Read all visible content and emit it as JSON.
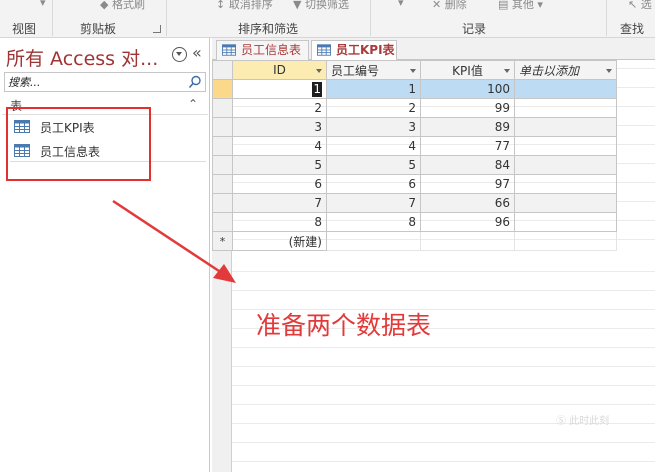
{
  "ribbon": {
    "groups": [
      {
        "label": "视图"
      },
      {
        "label": "剪贴板",
        "top": "格式刷"
      },
      {
        "label": "排序和筛选",
        "top_left": "取消排序",
        "top_right": "切换筛选"
      },
      {
        "label": "记录",
        "top_left": "删除",
        "top_right": "其他"
      },
      {
        "label": "查找",
        "top": "选"
      }
    ]
  },
  "nav": {
    "title": "所有 Access 对...",
    "search_placeholder": "搜索...",
    "group_label": "表",
    "items": [
      {
        "label": "员工KPI表"
      },
      {
        "label": "员工信息表"
      }
    ]
  },
  "tabs": [
    {
      "label": "员工信息表",
      "active": false
    },
    {
      "label": "员工KPI表",
      "active": true
    }
  ],
  "table": {
    "columns": [
      "ID",
      "员工编号",
      "KPI值",
      "单击以添加"
    ],
    "rows": [
      {
        "id": "1",
        "emp": "1",
        "kpi": "100"
      },
      {
        "id": "2",
        "emp": "2",
        "kpi": "99"
      },
      {
        "id": "3",
        "emp": "3",
        "kpi": "89"
      },
      {
        "id": "4",
        "emp": "4",
        "kpi": "77"
      },
      {
        "id": "5",
        "emp": "5",
        "kpi": "84"
      },
      {
        "id": "6",
        "emp": "6",
        "kpi": "97"
      },
      {
        "id": "7",
        "emp": "7",
        "kpi": "66"
      },
      {
        "id": "8",
        "emp": "8",
        "kpi": "96"
      }
    ],
    "new_row_marker": "*",
    "new_row_label": "(新建)"
  },
  "annotation": {
    "text": "准备两个数据表",
    "color": "#e23a3a"
  },
  "colors": {
    "nav_title": "#a03434",
    "highlight_box": "#e03030",
    "current_row": "#bddcf3",
    "id_header": "#fdecb2"
  }
}
